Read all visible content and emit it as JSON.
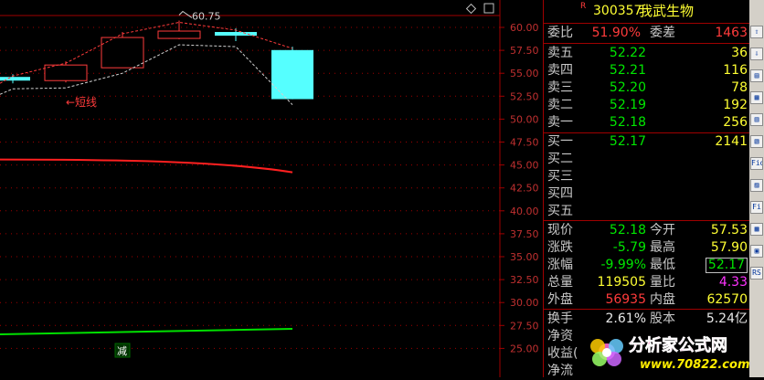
{
  "stock": {
    "flag": "R",
    "code": "300357",
    "name": "我武生物"
  },
  "chart": {
    "peak_label": "60.75",
    "short_label": "←短线",
    "bottom_label": "减",
    "price_ticks": [
      "60.00",
      "57.50",
      "55.00",
      "52.50",
      "50.00",
      "47.50",
      "45.00",
      "42.50",
      "40.00",
      "37.50",
      "35.00",
      "32.50",
      "30.00",
      "27.50",
      "25.00"
    ],
    "ymin": 25.0,
    "ymax": 60.0,
    "candles": [
      {
        "open": 54.6,
        "close": 54.2,
        "high": 54.9,
        "low": 53.9,
        "type": "down"
      },
      {
        "open": 54.2,
        "close": 55.9,
        "high": 56.3,
        "low": 54.0,
        "type": "up"
      },
      {
        "open": 55.6,
        "close": 58.9,
        "high": 59.5,
        "low": 55.6,
        "type": "up"
      },
      {
        "open": 58.8,
        "close": 59.6,
        "high": 60.75,
        "low": 58.7,
        "type": "up"
      },
      {
        "open": 59.5,
        "close": 59.2,
        "high": 59.9,
        "low": 58.5,
        "type": "down"
      },
      {
        "open": 57.53,
        "close": 52.18,
        "high": 57.9,
        "low": 52.17,
        "type": "down"
      }
    ],
    "colors": {
      "up": "#ff3b3b",
      "down": "#55ffff",
      "ma_red": "#ff2020",
      "ma_green": "#00e000",
      "axis": "#a00000",
      "grid": "#a00000"
    }
  },
  "quote": {
    "wei_bi": {
      "label": "委比",
      "value": "51.90%",
      "label2": "委差",
      "value2": "1463"
    },
    "asks": [
      {
        "label": "卖五",
        "price": "52.22",
        "vol": "36"
      },
      {
        "label": "卖四",
        "price": "52.21",
        "vol": "116"
      },
      {
        "label": "卖三",
        "price": "52.20",
        "vol": "78"
      },
      {
        "label": "卖二",
        "price": "52.19",
        "vol": "192"
      },
      {
        "label": "卖一",
        "price": "52.18",
        "vol": "256"
      }
    ],
    "bids": [
      {
        "label": "买一",
        "price": "52.17",
        "vol": "2141"
      },
      {
        "label": "买二",
        "price": "",
        "vol": ""
      },
      {
        "label": "买三",
        "price": "",
        "vol": ""
      },
      {
        "label": "买四",
        "price": "",
        "vol": ""
      },
      {
        "label": "买五",
        "price": "",
        "vol": ""
      }
    ],
    "stats": [
      {
        "l1": "现价",
        "v1": "52.18",
        "l2": "今开",
        "v2": "57.53"
      },
      {
        "l1": "涨跌",
        "v1": "-5.79",
        "l2": "最高",
        "v2": "57.90"
      },
      {
        "l1": "涨幅",
        "v1": "-9.99%",
        "l2": "最低",
        "v2": "52.17"
      },
      {
        "l1": "总量",
        "v1": "119505",
        "l2": "量比",
        "v2": "4.33"
      },
      {
        "l1": "外盘",
        "v1": "56935",
        "l2": "内盘",
        "v2": "62570"
      }
    ],
    "extra": [
      {
        "l1": "换手",
        "v1": "2.61%",
        "l2": "股本",
        "v2": "5.24亿"
      },
      {
        "l1": "净资",
        "v1": "",
        "l2": "",
        "v2": ""
      },
      {
        "l1": "收益(",
        "v1": "",
        "l2": "",
        "v2": ""
      },
      {
        "l1": "净流",
        "v1": "",
        "l2": "",
        "v2": ""
      }
    ]
  },
  "toolbar": {
    "buttons": [
      "⇧",
      "⇩",
      "▤",
      "▦",
      "▥",
      "▧",
      "Fio",
      "▨",
      "Fi",
      "▩",
      "▣",
      "RS"
    ]
  },
  "watermark": {
    "text": "分析家公式网",
    "url": "www.70822.com"
  }
}
